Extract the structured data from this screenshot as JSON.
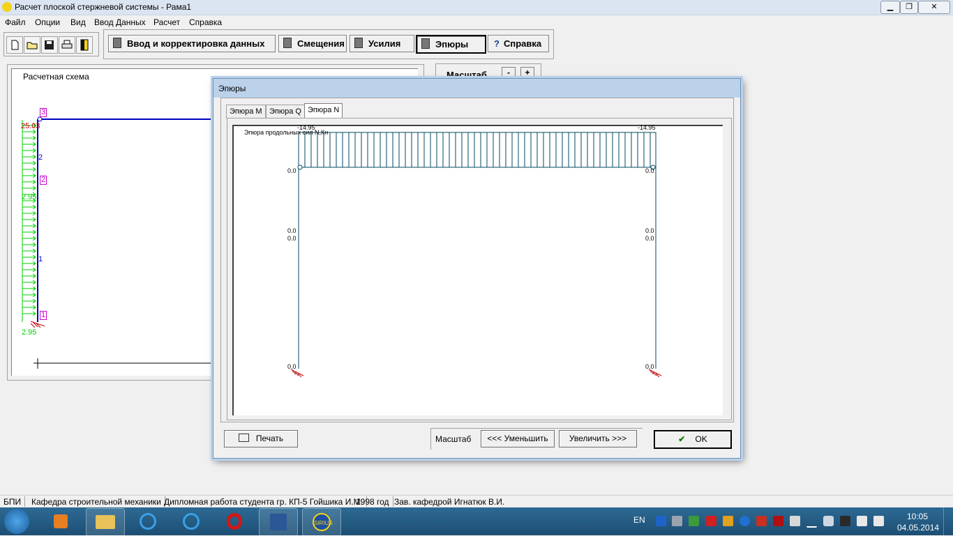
{
  "window": {
    "title": "Расчет плоской стержневой системы - Рама1",
    "minimize": "▁",
    "restore": "❐",
    "close": "✕"
  },
  "menu": [
    "Файл",
    "Опции",
    "Вид",
    "Ввод Данных",
    "Расчет",
    "Справка"
  ],
  "toolbar": {
    "icons": [
      "new-file-icon",
      "open-folder-icon",
      "save-icon",
      "print-icon",
      "exit-door-icon"
    ],
    "buttons": [
      {
        "label": "Ввод и корректировка данных",
        "icon": "edit-data-icon"
      },
      {
        "label": "Смещения",
        "icon": "calculator-icon"
      },
      {
        "label": "Усилия",
        "icon": "calculator-icon"
      },
      {
        "label": "Эпюры",
        "icon": "calculator-icon",
        "active": true
      },
      {
        "label": "Справка",
        "icon": "question-icon"
      }
    ]
  },
  "scheme": {
    "title": "Расчетная схема",
    "scale_label": "Масштаб",
    "scale_minus": "-",
    "scale_plus": "+",
    "node_labels": [
      "3",
      "2",
      "1"
    ],
    "element_labels": [
      "2",
      "1"
    ],
    "load_top": "25.03",
    "load_mid": "2.95",
    "load_bottom": "2.95"
  },
  "dialog": {
    "title": "Эпюры",
    "tabs": [
      "Эпюра M",
      "Эпюра Q",
      "Эпюра N"
    ],
    "active_tab": "Эпюра N",
    "plot_title": "Эпюра продольных сил N,Кн",
    "values": {
      "top_left": "-14.95",
      "top_right": "-14.95",
      "zero": "0.0"
    },
    "print_button": "Печать",
    "scale_label": "Масштаб",
    "decrease_button": "<<<   Уменьшить",
    "increase_button": "Увеличить   >>>",
    "ok_button": "OK"
  },
  "statusbar": [
    "БПИ",
    "Кафедра строительной механики",
    "Дипломная работа студента гр. КП-5 Гойшика И.М.",
    "1998 год",
    "Зав. кафедрой Игнатюк В.И."
  ],
  "taskbar": {
    "language": "EN",
    "time": "10:05",
    "date": "04.05.2014",
    "sirius_label": "SIRIUS"
  },
  "colors": {
    "frame_blue": "#0000c0",
    "load_green": "#00cc00",
    "label_magenta": "#cc00cc",
    "diagram_teal": "#004a60"
  }
}
